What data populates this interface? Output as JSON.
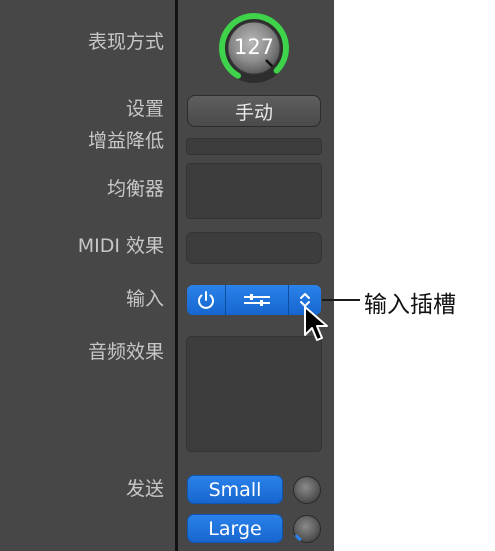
{
  "labels": {
    "mode": "表现方式",
    "settings": "设置",
    "gain_reduction": "增益降低",
    "eq": "均衡器",
    "midi_fx": "MIDI 效果",
    "input": "输入",
    "audio_fx": "音频效果",
    "sends": "发送"
  },
  "volume_knob": {
    "value": "127",
    "level": 0.95,
    "accent": "#3fd24b"
  },
  "settings_button": {
    "label": "手动"
  },
  "input_slot": {
    "power_icon": "power-icon",
    "settings_icon": "sliders-icon",
    "menu_icon": "up-down-chevron-icon",
    "accent": "#1f74de"
  },
  "sends": [
    {
      "label": "Small"
    },
    {
      "label": "Large"
    }
  ],
  "callout": {
    "text": "输入插槽"
  }
}
